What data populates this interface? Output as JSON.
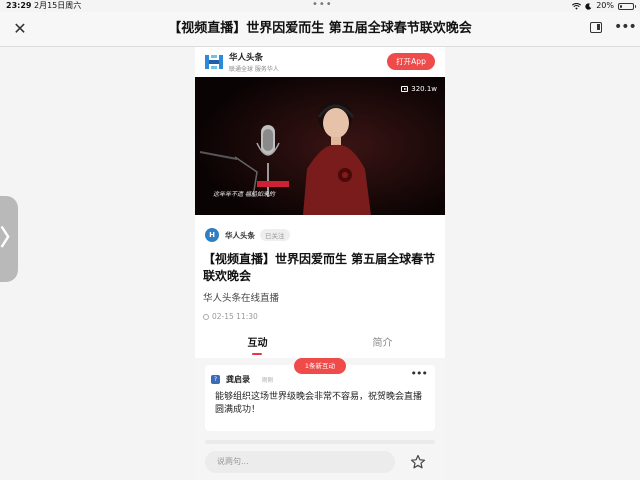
{
  "status_bar": {
    "time": "23:29",
    "date": "2月15日周六",
    "battery_text": "20%",
    "battery_level": 0.2
  },
  "navbar": {
    "title": "【视频直播】世界因爱而生 第五届全球春节联欢晚会"
  },
  "app_banner": {
    "name": "华人头条",
    "slogan": "联通全球 服务华人",
    "open_button": "打开App",
    "accent": "#ef4b4b"
  },
  "video": {
    "view_count": "320.1w",
    "subtitle": "这年年不遗 福船如来的"
  },
  "author": {
    "name": "华人头条",
    "follow_status": "已关注"
  },
  "article": {
    "title": "【视频直播】世界因爱而生 第五届全球春节联欢晚会",
    "subtitle": "华人头条在线直播",
    "date": "02-15 11:30"
  },
  "tabs": [
    {
      "label": "互动",
      "active": true
    },
    {
      "label": "简介",
      "active": false
    }
  ],
  "interaction": {
    "new_badge": "1条新互动",
    "comment": {
      "author": "龚启录",
      "time": "刚刚",
      "text": "能够组织这场世界级晚会非常不容易，祝贺晚会直播圆满成功！"
    },
    "input_placeholder": "说两句..."
  },
  "icons": {
    "close": "close-icon",
    "window": "window-icon",
    "more": "more-icon",
    "star": "star-icon"
  }
}
